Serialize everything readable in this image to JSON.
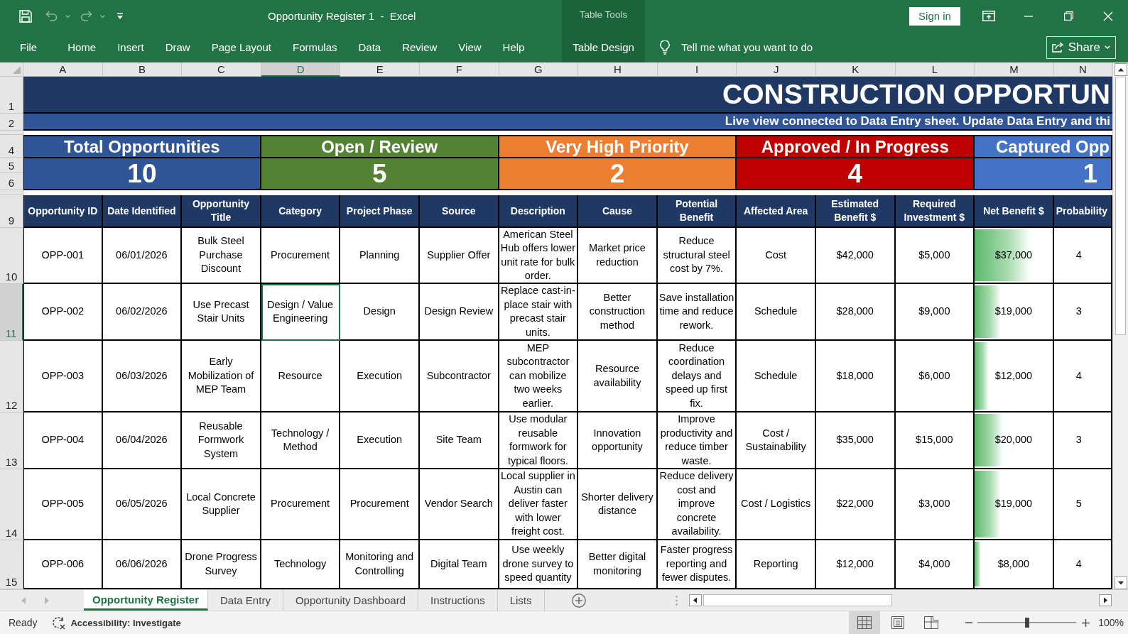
{
  "title_bar": {
    "document_title": "Opportunity Register 1  -  Excel",
    "sign_in": "Sign in"
  },
  "ribbon": {
    "tabs": [
      {
        "label": "File",
        "selected": false
      },
      {
        "label": "Home",
        "selected": false
      },
      {
        "label": "Insert",
        "selected": false
      },
      {
        "label": "Draw",
        "selected": false
      },
      {
        "label": "Page Layout",
        "selected": false
      },
      {
        "label": "Formulas",
        "selected": false
      },
      {
        "label": "Data",
        "selected": false
      },
      {
        "label": "Review",
        "selected": false
      },
      {
        "label": "View",
        "selected": false
      },
      {
        "label": "Help",
        "selected": false
      }
    ],
    "context_group": {
      "label": "Table Tools",
      "tabs": [
        {
          "label": "Table Design",
          "selected": false
        }
      ]
    },
    "tell_me": {
      "placeholder": "Tell me what you want to do"
    },
    "share": "Share"
  },
  "sheet": {
    "columns": [
      {
        "letter": "A",
        "selected": false
      },
      {
        "letter": "B",
        "selected": false
      },
      {
        "letter": "C",
        "selected": false
      },
      {
        "letter": "D",
        "selected": true
      },
      {
        "letter": "E",
        "selected": false
      },
      {
        "letter": "F",
        "selected": false
      },
      {
        "letter": "G",
        "selected": false
      },
      {
        "letter": "H",
        "selected": false
      },
      {
        "letter": "I",
        "selected": false
      },
      {
        "letter": "J",
        "selected": false
      },
      {
        "letter": "K",
        "selected": false
      },
      {
        "letter": "L",
        "selected": false
      },
      {
        "letter": "M",
        "selected": false
      },
      {
        "letter": "N",
        "selected": false
      }
    ],
    "banner": {
      "row": "1",
      "title": "CONSTRUCTION OPPORTUN"
    },
    "subtitle": {
      "row": "2",
      "text": "Live view connected to Data Entry sheet. Update Data Entry and thi"
    },
    "kpi_rows": [
      "4",
      "5",
      "6"
    ],
    "kpis": [
      {
        "label": "Total Opportunities",
        "value": "10",
        "color": "#2f5597"
      },
      {
        "label": "Open / Review",
        "value": "5",
        "color": "#548235"
      },
      {
        "label": "Very High Priority",
        "value": "2",
        "color": "#ed7d31"
      },
      {
        "label": "Approved / In Progress",
        "value": "4",
        "color": "#c00000"
      },
      {
        "label": "Captured Opp",
        "value": "1",
        "color": "#4472c4"
      }
    ],
    "table": {
      "row": "9",
      "headers": [
        {
          "label": "Opportunity ID",
          "kind": "text"
        },
        {
          "label": "Date Identified",
          "kind": "text"
        },
        {
          "label": "Opportunity Title",
          "kind": "text"
        },
        {
          "label": "Category",
          "kind": "text"
        },
        {
          "label": "Project Phase",
          "kind": "text"
        },
        {
          "label": "Source",
          "kind": "text"
        },
        {
          "label": "Description",
          "kind": "text"
        },
        {
          "label": "Cause",
          "kind": "text"
        },
        {
          "label": "Potential Benefit",
          "kind": "text"
        },
        {
          "label": "Affected Area",
          "kind": "text"
        },
        {
          "label": "Estimated Benefit $",
          "kind": "text"
        },
        {
          "label": "Required Investment $",
          "kind": "text"
        },
        {
          "label": "Net Benefit $",
          "kind": "data_bar"
        },
        {
          "label": "Probability",
          "kind": "text"
        }
      ],
      "rows": [
        {
          "row": "10",
          "selected": false,
          "level": 0.72,
          "cells": [
            "OPP-001",
            "06/01/2026",
            "Bulk Steel Purchase Discount",
            "Procurement",
            "Planning",
            "Supplier Offer",
            "American Steel Hub offers lower unit rate for bulk order.",
            "Market price reduction",
            "Reduce structural steel cost by 7%.",
            "Cost",
            "$42,000",
            "$5,000",
            "$37,000",
            "4"
          ]
        },
        {
          "row": "11",
          "selected": true,
          "level": 0.34,
          "cells": [
            "OPP-002",
            "06/02/2026",
            "Use Precast Stair Units",
            "Design / Value Engineering",
            "Design",
            "Design Review",
            "Replace cast-in-place stair with precast stair units.",
            "Better construction method",
            "Save installation time and reduce rework.",
            "Schedule",
            "$28,000",
            "$9,000",
            "$19,000",
            "3"
          ]
        },
        {
          "row": "12",
          "selected": false,
          "level": 0.18,
          "cells": [
            "OPP-003",
            "06/03/2026",
            "Early Mobilization of MEP Team",
            "Resource",
            "Execution",
            "Subcontractor",
            "MEP subcontractor can mobilize two weeks earlier.",
            "Resource availability",
            "Reduce coordination delays and speed up first fix.",
            "Schedule",
            "$18,000",
            "$6,000",
            "$12,000",
            "4"
          ]
        },
        {
          "row": "13",
          "selected": false,
          "level": 0.36,
          "cells": [
            "OPP-004",
            "06/04/2026",
            "Reusable Formwork System",
            "Technology / Method",
            "Execution",
            "Site Team",
            "Use modular reusable formwork for typical floors.",
            "Innovation opportunity",
            "Improve productivity and reduce timber waste.",
            "Cost / Sustainability",
            "$35,000",
            "$15,000",
            "$20,000",
            "3"
          ]
        },
        {
          "row": "14",
          "selected": false,
          "level": 0.34,
          "cells": [
            "OPP-005",
            "06/05/2026",
            "Local Concrete Supplier",
            "Procurement",
            "Procurement",
            "Vendor Search",
            "Local supplier in Austin can deliver faster with lower freight cost.",
            "Shorter delivery distance",
            "Reduce delivery cost and improve concrete availability.",
            "Cost / Logistics",
            "$22,000",
            "$3,000",
            "$19,000",
            "5"
          ]
        },
        {
          "row": "15",
          "selected": false,
          "level": 0.08,
          "cells": [
            "OPP-006",
            "06/06/2026",
            "Drone Progress Survey",
            "Technology",
            "Monitoring and Controlling",
            "Digital Team",
            "Use weekly drone survey to speed quantity",
            "Better digital monitoring",
            "Faster progress reporting and fewer disputes.",
            "Reporting",
            "$12,000",
            "$4,000",
            "$8,000",
            "4"
          ]
        }
      ]
    }
  },
  "sheet_tabs": [
    {
      "label": "Opportunity Register",
      "selected": true
    },
    {
      "label": "Data Entry",
      "selected": false
    },
    {
      "label": "Opportunity Dashboard",
      "selected": false
    },
    {
      "label": "Instructions",
      "selected": false
    },
    {
      "label": "Lists",
      "selected": false
    }
  ],
  "status_bar": {
    "status": "Ready",
    "accessibility": "Accessibility: Investigate",
    "views": [
      {
        "kind": "normal",
        "selected": true
      },
      {
        "kind": "page_layout",
        "selected": false
      },
      {
        "kind": "page_break",
        "selected": false
      }
    ],
    "zoom": {
      "level": 0.5,
      "reading": "100%"
    }
  }
}
